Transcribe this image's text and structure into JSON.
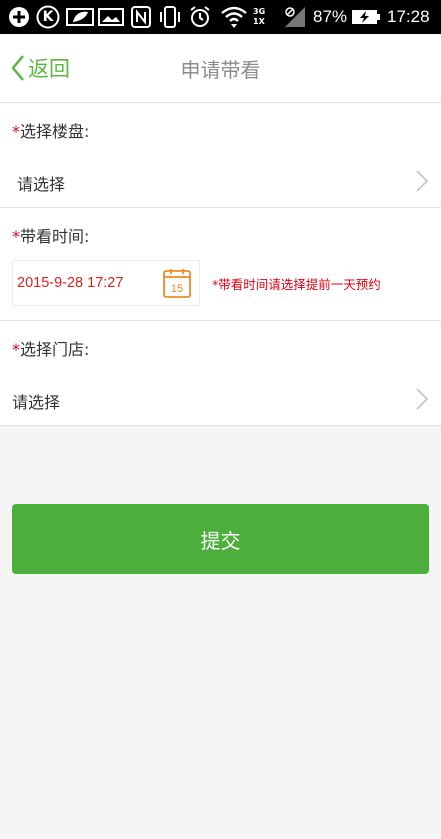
{
  "status_bar": {
    "battery": "87%",
    "time": "17:28",
    "net_3g": "3G",
    "net_1x": "1X",
    "app_icon_letter": "K"
  },
  "nav": {
    "back_label": "返回",
    "title": "申请带看"
  },
  "form": {
    "property": {
      "required_mark": "*",
      "label": "选择楼盘:",
      "placeholder": "请选择"
    },
    "time": {
      "required_mark": "*",
      "label": "带看时间:",
      "value": "2015-9-28 17:27",
      "calendar_day": "15",
      "hint": "*带看时间请选择提前一天预约"
    },
    "store": {
      "required_mark": "*",
      "label": "选择门店:",
      "placeholder": "请选择"
    }
  },
  "submit_label": "提交",
  "colors": {
    "accent_green": "#4caf3c",
    "back_green": "#5cb83c",
    "required_red": "#e60012",
    "date_red": "#d8231f",
    "calendar_orange": "#f08a24"
  }
}
